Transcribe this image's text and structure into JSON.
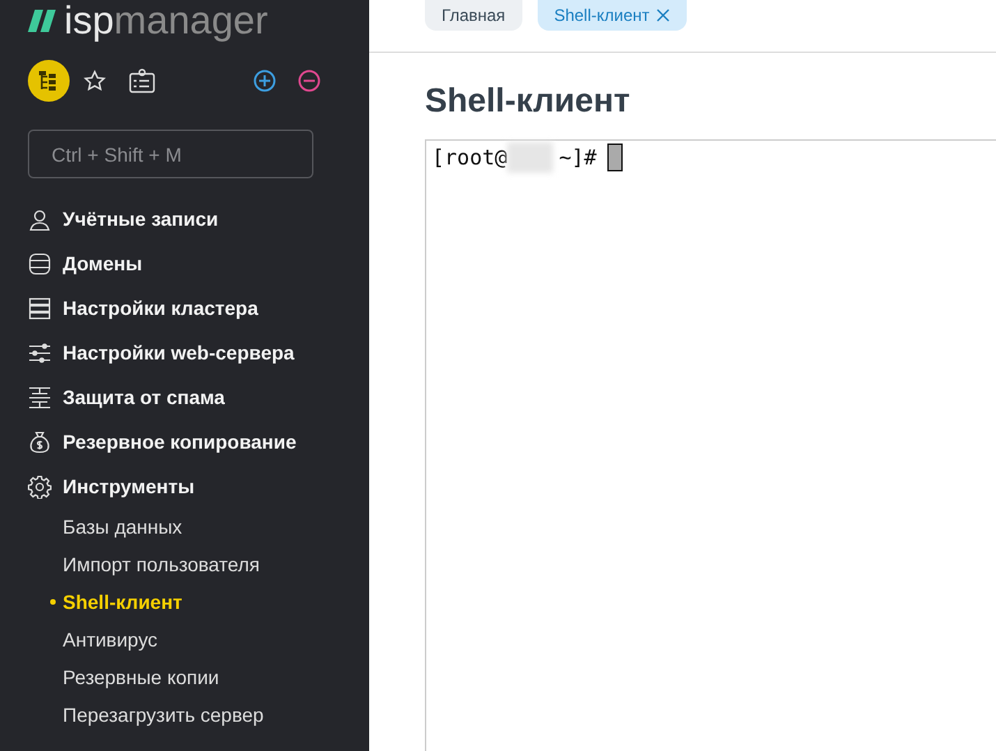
{
  "logo": {
    "prefix": "isp",
    "suffix": "manager"
  },
  "search": {
    "placeholder": "Ctrl + Shift + M"
  },
  "nav": [
    {
      "label": "Учётные записи",
      "kind": "user"
    },
    {
      "label": "Домены",
      "kind": "domain"
    },
    {
      "label": "Настройки кластера",
      "kind": "servers"
    },
    {
      "label": "Настройки web-сервера",
      "kind": "sliders"
    },
    {
      "label": "Защита от спама",
      "kind": "wall"
    },
    {
      "label": "Резервное копирование",
      "kind": "moneybag"
    },
    {
      "label": "Инструменты",
      "kind": "gear",
      "children": [
        {
          "label": "Базы данных",
          "selected": false
        },
        {
          "label": "Импорт пользователя",
          "selected": false
        },
        {
          "label": "Shell-клиент",
          "selected": true
        },
        {
          "label": "Антивирус",
          "selected": false
        },
        {
          "label": "Резервные копии",
          "selected": false
        },
        {
          "label": "Перезагрузить сервер",
          "selected": false
        }
      ]
    }
  ],
  "tabs": [
    {
      "label": "Главная",
      "selected": false,
      "closable": false
    },
    {
      "label": "Shell-клиент",
      "selected": true,
      "closable": true
    }
  ],
  "heading": "Shell-клиент",
  "terminal": {
    "prompt_start": "[root@",
    "prompt_end": "~]#"
  }
}
